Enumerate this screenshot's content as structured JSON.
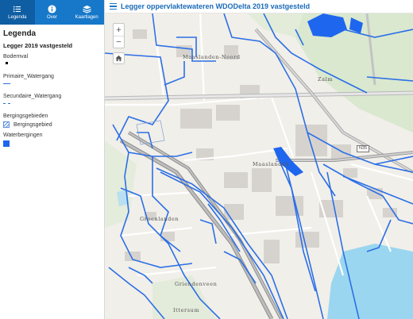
{
  "header": {
    "title": "Legger oppervlaktewateren WDODelta 2019 vastgesteld"
  },
  "sidebar": {
    "tabs": [
      {
        "label": "Legenda",
        "icon": "list-icon",
        "active": true
      },
      {
        "label": "Over",
        "icon": "info-icon",
        "active": false
      },
      {
        "label": "Kaartlagen",
        "icon": "layers-icon",
        "active": false
      }
    ],
    "title": "Legenda",
    "subtitle": "Legger 2019 vastgesteld",
    "legend": {
      "bodemval": "Bodemval",
      "primaire": "Primaire_Watergang",
      "secundaire": "Secundaire_Watergang",
      "bergingsgebieden": "Bergingsgebieden",
      "bergingsgebied": "Bergingsgebied",
      "waterbergingen": "Waterbergingen"
    },
    "colors": {
      "primary_water": "#2f6fd6",
      "storage_fill": "#1f66ee",
      "tab_bar": "#1778c9"
    }
  },
  "map": {
    "controls": {
      "zoom_in": "+",
      "zoom_out": "−"
    },
    "labels": {
      "maaslanden_noord": "Maaslanden-Noord",
      "zalm": "Zalm",
      "maaslanden": "Maaslanden",
      "groenlanden": "Groenlanden",
      "griendenveen": "Griendenveen",
      "ittersum": "Ittersum",
      "n35": "N35"
    },
    "colors": {
      "water_line": "#2c6fe6",
      "water_body": "#9ad6ef",
      "background": "#f1efe9"
    }
  }
}
